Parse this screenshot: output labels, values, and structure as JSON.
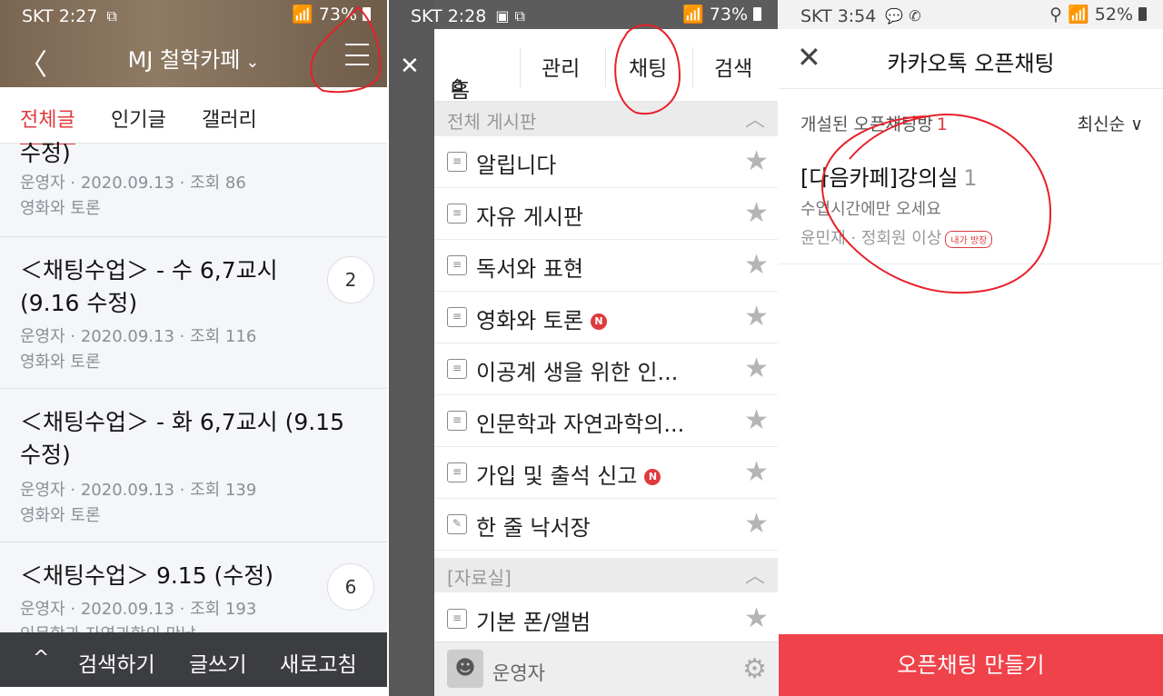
{
  "panel1": {
    "status": {
      "carrier": "SKT 2:27",
      "battery": "73%"
    },
    "title": "MJ 철학카페",
    "tabs": [
      "전체글",
      "인기글",
      "갤러리"
    ],
    "partial_post": {
      "title_tail": "수정)",
      "author": "운영자",
      "date": "2020.09.13",
      "views": "조회 86",
      "board": "영화와 토론"
    },
    "posts": [
      {
        "title": "＜채팅수업＞ - 수 6,7교시 (9.16 수정)",
        "author": "운영자",
        "date": "2020.09.13",
        "views": "조회 116",
        "board": "영화와 토론",
        "comments": "2"
      },
      {
        "title": "＜채팅수업＞ - 화 6,7교시 (9.15 수정)",
        "author": "운영자",
        "date": "2020.09.13",
        "views": "조회 139",
        "board": "영화와 토론",
        "comments": ""
      },
      {
        "title": "＜채팅수업＞ 9.15 (수정)",
        "author": "운영자",
        "date": "2020.09.13",
        "views": "조회 193",
        "board": "인문학과 자연과학의 만남",
        "comments": "6"
      }
    ],
    "bottom": {
      "up": "^",
      "search": "검색하기",
      "write": "글쓰기",
      "refresh": "새로고침"
    }
  },
  "panel2": {
    "status": {
      "carrier": "SKT 2:28",
      "battery": "73%"
    },
    "nav": {
      "home": "홈",
      "manage": "관리",
      "chat": "채팅",
      "search": "검색"
    },
    "section1": "전체 게시판",
    "boards": [
      {
        "label": "알립니다",
        "new": false
      },
      {
        "label": "자유 게시판",
        "new": false
      },
      {
        "label": "독서와 표현",
        "new": false
      },
      {
        "label": "영화와 토론",
        "new": true
      },
      {
        "label": "이공계 생을 위한 인...",
        "new": false
      },
      {
        "label": "인문학과 자연과학의...",
        "new": false
      },
      {
        "label": "가입 및 출석 신고",
        "new": true
      },
      {
        "label": "한 줄 낙서장",
        "new": false
      }
    ],
    "section2": "[자료실]",
    "boards2": [
      {
        "label": "기본 폰/앨범",
        "new": false
      }
    ],
    "new_badge": "N",
    "user": "운영자"
  },
  "panel3": {
    "status": {
      "carrier": "SKT 3:54",
      "battery": "52%"
    },
    "title": "카카오톡 오픈채팅",
    "subtitle": "개설된 오픈채팅방",
    "count": "1",
    "sort": "최신순 ∨",
    "room": {
      "name": "[다음카페]강의실",
      "members": "1",
      "desc": "수업시간에만 오세요",
      "owner": "윤민재",
      "level": "정회원 이상",
      "badge": "내가 방장"
    },
    "create_button": "오픈채팅 만들기"
  },
  "colors": {
    "accent": "#e03a3e",
    "annotation": "#e8202a",
    "create": "#f0424a"
  }
}
